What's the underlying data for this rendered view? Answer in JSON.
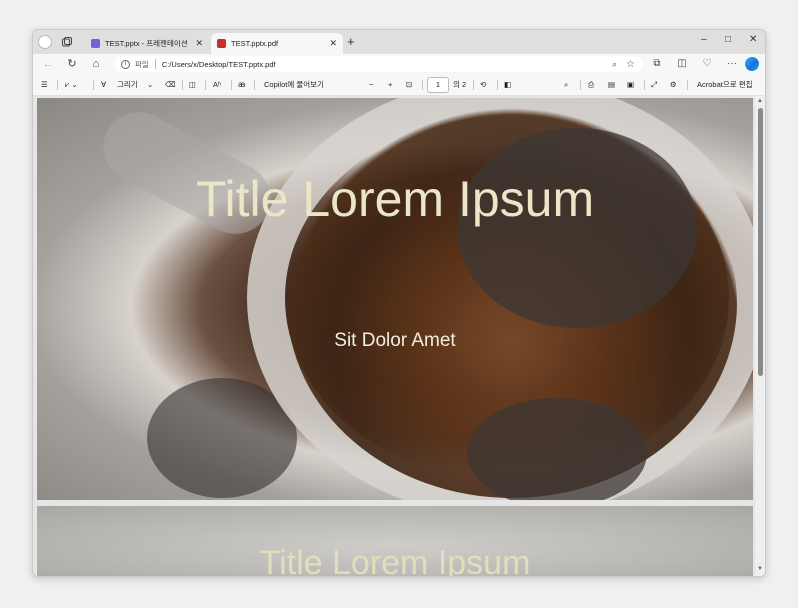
{
  "tabs": [
    {
      "label": "TEST.pptx - 프레젠테이션",
      "active": false,
      "favicon_color": "#7b5cd6"
    },
    {
      "label": "TEST.pptx.pdf",
      "active": true,
      "favicon_color": "#c4312b"
    }
  ],
  "window_controls": {
    "minimize": "–",
    "maximize": "□",
    "close": "✕"
  },
  "address": {
    "site_label": "파일",
    "url": "C:/Users/x/Desktop/TEST.pptx.pdf"
  },
  "pdf_toolbar": {
    "draw_label": "그리기",
    "copilot_label": "Copilot에 물어보기",
    "zoom_out": "−",
    "zoom_in": "+",
    "page_current": "1",
    "page_total": "의 2",
    "acrobat_label": "Acrobat으로 편집"
  },
  "slides": [
    {
      "title": "Title Lorem Ipsum",
      "subtitle": "Sit Dolor Amet"
    },
    {
      "title": "Title Lorem Ipsum"
    }
  ],
  "colors": {
    "slide_title": "#ece6c9",
    "accent": "#1d6ce0"
  }
}
